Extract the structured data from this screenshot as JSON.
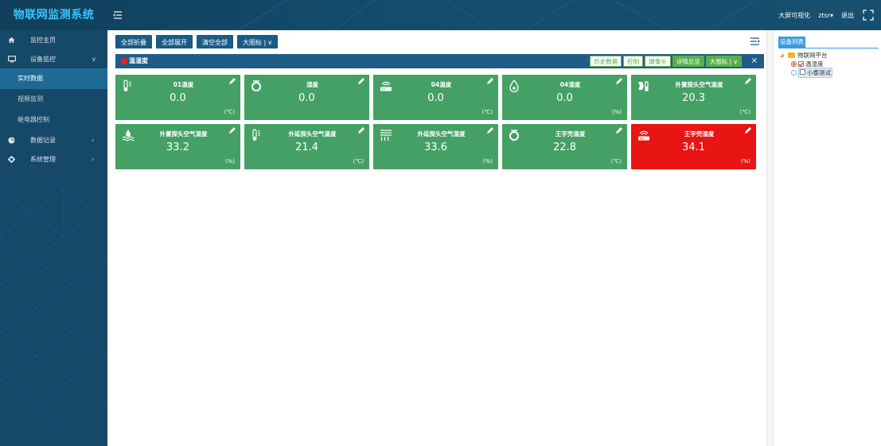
{
  "app": {
    "title": "物联网监测系统"
  },
  "topbar": {
    "big_screen": "大屏可视化",
    "user": "ztsr",
    "logout": "退出"
  },
  "sidebar": {
    "items": [
      {
        "label": "监控主页",
        "icon": "home-icon",
        "arrow": ""
      },
      {
        "label": "设备监控",
        "icon": "monitor-icon",
        "arrow": "∨"
      }
    ],
    "sub_items": [
      {
        "label": "实时数据",
        "active": true
      },
      {
        "label": "视频监测",
        "active": false
      },
      {
        "label": "继电器控制",
        "active": false
      }
    ],
    "bottom_items": [
      {
        "label": "数据记录",
        "icon": "pie-chart-icon",
        "arrow": "›"
      },
      {
        "label": "系统管理",
        "icon": "gear-icon",
        "arrow": "›"
      }
    ]
  },
  "toolbar": {
    "collapse_all": "全部折叠",
    "expand_all": "全部展开",
    "clear_all": "清空全部",
    "big_icon": "大图标 |",
    "big_icon_caret": "∨"
  },
  "panel": {
    "title": "温湿度",
    "actions": [
      {
        "label": "历史数据",
        "filled": false
      },
      {
        "label": "控制",
        "filled": false
      },
      {
        "label": "摄像头",
        "filled": false
      },
      {
        "label": "详情总览",
        "filled": true
      },
      {
        "label": "大图标 | ∨",
        "filled": true
      }
    ],
    "close": "×"
  },
  "cards": [
    {
      "name": "01温度",
      "value": "0.0",
      "unit": "(℃)",
      "icon": "thermometer-icon",
      "alarm": false
    },
    {
      "name": "湿度",
      "value": "0.0",
      "unit": "",
      "icon": "ring-icon",
      "alarm": false
    },
    {
      "name": "04温度",
      "value": "0.0",
      "unit": "(℃)",
      "icon": "router-icon",
      "alarm": false
    },
    {
      "name": "04湿度",
      "value": "0.0",
      "unit": "(%)",
      "icon": "water-drop-icon",
      "alarm": false
    },
    {
      "name": "外置探头空气温度",
      "value": "20.3",
      "unit": "(℃)",
      "icon": "sensor-icon",
      "alarm": false
    },
    {
      "name": "外置探头空气湿度",
      "value": "33.2",
      "unit": "(%)",
      "icon": "water-wave-icon",
      "alarm": false
    },
    {
      "name": "外延探头空气温度",
      "value": "21.4",
      "unit": "(℃)",
      "icon": "thermometer-icon",
      "alarm": false
    },
    {
      "name": "外延探头空气湿度",
      "value": "33.6",
      "unit": "(%)",
      "icon": "mist-icon",
      "alarm": false
    },
    {
      "name": "王字壳温度",
      "value": "22.8",
      "unit": "(℃)",
      "icon": "ring-icon",
      "alarm": false
    },
    {
      "name": "王字壳湿度",
      "value": "34.1",
      "unit": "(%)",
      "icon": "router-icon",
      "alarm": true
    }
  ],
  "device_panel": {
    "tab": "设备列表",
    "root": "物联网平台",
    "nodes": [
      {
        "label": "温湿度",
        "radio": true,
        "checked": true,
        "selected": false
      },
      {
        "label": "小泰测试",
        "radio": false,
        "checked": false,
        "selected": true
      }
    ]
  }
}
